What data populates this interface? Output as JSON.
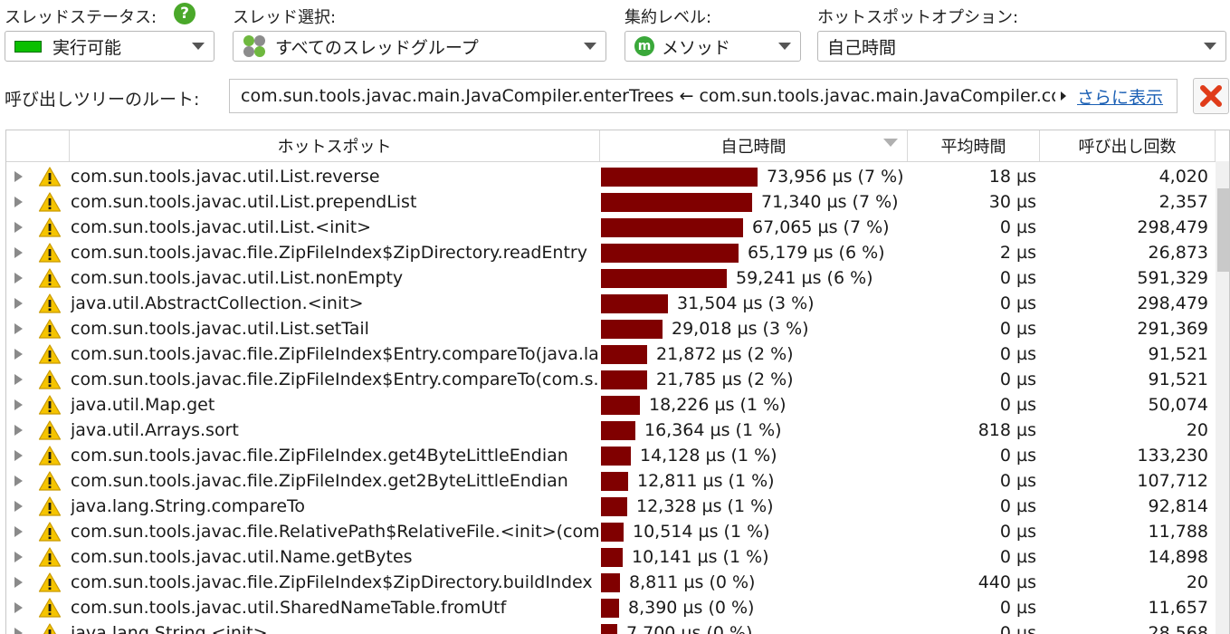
{
  "controls": {
    "thread_status_label": "スレッドステータス:",
    "thread_status_value": "実行可能",
    "thread_select_label": "スレッド選択:",
    "thread_select_value": "すべてのスレッドグループ",
    "aggregation_label": "集約レベル:",
    "aggregation_value": "メソッド",
    "hotspot_options_label": "ホットスポットオプション:",
    "hotspot_options_value": "自己時間",
    "call_tree_root_label": "呼び出しツリーのルート:",
    "call_tree_root_value": "com.sun.tools.javac.main.JavaCompiler.enterTrees ← com.sun.tools.javac.main.JavaCompiler.compile",
    "show_more_label": "さらに表示",
    "help_glyph": "?",
    "method_glyph": "m"
  },
  "colors": {
    "bar": "#800000",
    "status_green": "#0bbf00",
    "link": "#1a5fb4"
  },
  "table": {
    "columns": [
      "ホットスポット",
      "自己時間",
      "平均時間",
      "呼び出し回数"
    ],
    "rows": [
      {
        "name": "com.sun.tools.javac.util.List.reverse",
        "self_time": "73,956 µs (7 %)",
        "avg": "18 µs",
        "calls": "4,020",
        "value": 73956
      },
      {
        "name": "com.sun.tools.javac.util.List.prependList",
        "self_time": "71,340 µs (7 %)",
        "avg": "30 µs",
        "calls": "2,357",
        "value": 71340
      },
      {
        "name": "com.sun.tools.javac.util.List.<init>",
        "self_time": "67,065 µs (7 %)",
        "avg": "0 µs",
        "calls": "298,479",
        "value": 67065
      },
      {
        "name": "com.sun.tools.javac.file.ZipFileIndex$ZipDirectory.readEntry",
        "self_time": "65,179 µs (6 %)",
        "avg": "2 µs",
        "calls": "26,873",
        "value": 65179
      },
      {
        "name": "com.sun.tools.javac.util.List.nonEmpty",
        "self_time": "59,241 µs (6 %)",
        "avg": "0 µs",
        "calls": "591,329",
        "value": 59241
      },
      {
        "name": "java.util.AbstractCollection.<init>",
        "self_time": "31,504 µs (3 %)",
        "avg": "0 µs",
        "calls": "298,479",
        "value": 31504
      },
      {
        "name": "com.sun.tools.javac.util.List.setTail",
        "self_time": "29,018 µs (3 %)",
        "avg": "0 µs",
        "calls": "291,369",
        "value": 29018
      },
      {
        "name": "com.sun.tools.javac.file.ZipFileIndex$Entry.compareTo(java.la...",
        "self_time": "21,872 µs (2 %)",
        "avg": "0 µs",
        "calls": "91,521",
        "value": 21872
      },
      {
        "name": "com.sun.tools.javac.file.ZipFileIndex$Entry.compareTo(com.s...",
        "self_time": "21,785 µs (2 %)",
        "avg": "0 µs",
        "calls": "91,521",
        "value": 21785
      },
      {
        "name": "java.util.Map.get",
        "self_time": "18,226 µs (1 %)",
        "avg": "0 µs",
        "calls": "50,074",
        "value": 18226
      },
      {
        "name": "java.util.Arrays.sort",
        "self_time": "16,364 µs (1 %)",
        "avg": "818 µs",
        "calls": "20",
        "value": 16364
      },
      {
        "name": "com.sun.tools.javac.file.ZipFileIndex.get4ByteLittleEndian",
        "self_time": "14,128 µs (1 %)",
        "avg": "0 µs",
        "calls": "133,230",
        "value": 14128
      },
      {
        "name": "com.sun.tools.javac.file.ZipFileIndex.get2ByteLittleEndian",
        "self_time": "12,811 µs (1 %)",
        "avg": "0 µs",
        "calls": "107,712",
        "value": 12811
      },
      {
        "name": "java.lang.String.compareTo",
        "self_time": "12,328 µs (1 %)",
        "avg": "0 µs",
        "calls": "92,814",
        "value": 12328
      },
      {
        "name": "com.sun.tools.javac.file.RelativePath$RelativeFile.<init>(com....",
        "self_time": "10,514 µs (1 %)",
        "avg": "0 µs",
        "calls": "11,788",
        "value": 10514
      },
      {
        "name": "com.sun.tools.javac.util.Name.getBytes",
        "self_time": "10,141 µs (1 %)",
        "avg": "0 µs",
        "calls": "14,898",
        "value": 10141
      },
      {
        "name": "com.sun.tools.javac.file.ZipFileIndex$ZipDirectory.buildIndex",
        "self_time": "8,811 µs (0 %)",
        "avg": "440 µs",
        "calls": "20",
        "value": 8811
      },
      {
        "name": "com.sun.tools.javac.util.SharedNameTable.fromUtf",
        "self_time": "8,390 µs (0 %)",
        "avg": "0 µs",
        "calls": "11,657",
        "value": 8390
      },
      {
        "name": "java.lang.String.<init>",
        "self_time": "7,700 µs (0 %)",
        "avg": "0 µs",
        "calls": "28,568",
        "value": 7700
      }
    ]
  }
}
